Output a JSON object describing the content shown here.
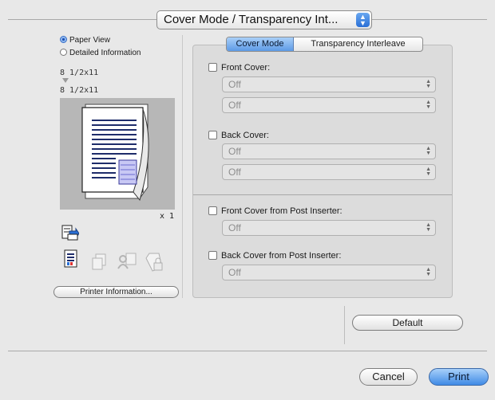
{
  "section_popup": {
    "value": "Cover Mode / Transparency Int..."
  },
  "view_options": {
    "paper_view": "Paper View",
    "detailed_information": "Detailed Information"
  },
  "preview": {
    "size_top": "8 1/2x11",
    "size_bottom": "8 1/2x11",
    "copies": "x 1",
    "printer_info_label": "Printer Information..."
  },
  "tabs": [
    {
      "label": "Cover Mode",
      "active": true
    },
    {
      "label": "Transparency Interleave",
      "active": false
    }
  ],
  "covers": {
    "front_cover_label": "Front Cover:",
    "front_cover_select1": "Off",
    "front_cover_select2": "Off",
    "back_cover_label": "Back Cover:",
    "back_cover_select1": "Off",
    "back_cover_select2": "Off",
    "front_post_label": "Front Cover from Post Inserter:",
    "front_post_select": "Off",
    "back_post_label": "Back Cover from Post Inserter:",
    "back_post_select": "Off"
  },
  "buttons": {
    "default": "Default",
    "cancel": "Cancel",
    "print": "Print"
  },
  "colors": {
    "accent_blue": "#3f8ae6",
    "preview_bg": "#b7b7b7",
    "window_bg": "#e8e8e8"
  }
}
